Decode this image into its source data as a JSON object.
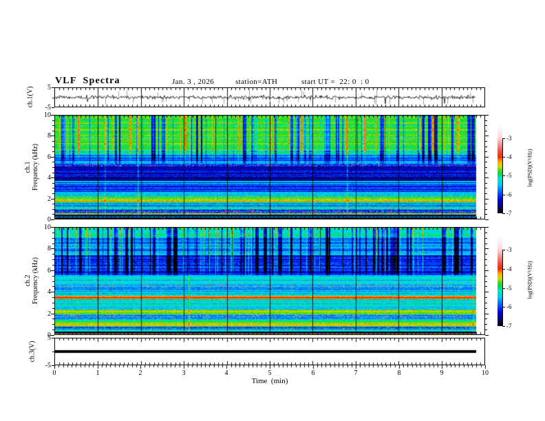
{
  "header": {
    "title": "VLF  Spectra",
    "date": "Jan. 3 , 2026",
    "station": "station=ATH",
    "start_ut": "start UT =  22: 0  : 0"
  },
  "time_axis": {
    "label": "Time  (min)",
    "ticks": [
      "0",
      "1",
      "2",
      "3",
      "4",
      "5",
      "6",
      "7",
      "8",
      "9",
      "10"
    ],
    "range_min": [
      0,
      10
    ],
    "minor_step_min": 0.1,
    "data_end_min": 9.8
  },
  "panels": {
    "ch1_wave": {
      "name": "ch.1(V)",
      "yticks": [
        "5",
        "-5"
      ],
      "ylim": [
        -5,
        5
      ]
    },
    "ch1_spec": {
      "name_line1": "ch.1",
      "name_line2": "Frequency  (kHz)",
      "yticks": [
        "10",
        "8",
        "6",
        "4",
        "2",
        "0"
      ],
      "ylim_khz": [
        0,
        10
      ]
    },
    "ch2_spec": {
      "name_line1": "ch.2",
      "name_line2": "Frequency  (kHz)",
      "yticks": [
        "10",
        "8",
        "6",
        "4",
        "2",
        "0"
      ],
      "ylim_khz": [
        0,
        10
      ]
    },
    "ch3_wave": {
      "name": "ch.3(V)",
      "yticks": [
        "5",
        "-5"
      ],
      "ylim": [
        -5,
        5
      ]
    }
  },
  "colorbar": {
    "label": "log(PSD)(V²/Hz)",
    "ticks": [
      "-3",
      "-4",
      "-5",
      "-6",
      "-7"
    ],
    "range": [
      -7,
      -2.2
    ],
    "stops": [
      [
        -7.0,
        "#000000"
      ],
      [
        -6.75,
        "#0a0a5a"
      ],
      [
        -6.3,
        "#0000e6"
      ],
      [
        -5.9,
        "#005aff"
      ],
      [
        -5.5,
        "#00c8ff"
      ],
      [
        -5.15,
        "#00e6c8"
      ],
      [
        -4.9,
        "#00dc50"
      ],
      [
        -4.7,
        "#50dc00"
      ],
      [
        -4.5,
        "#d2dc00"
      ],
      [
        -4.25,
        "#ffaa00"
      ],
      [
        -4.0,
        "#ff2800"
      ],
      [
        -3.7,
        "#ff4646"
      ],
      [
        -3.3,
        "#ff9696"
      ],
      [
        -3.0,
        "#ffd2d2"
      ],
      [
        -2.5,
        "#fff5f5"
      ],
      [
        -2.2,
        "#ffffff"
      ]
    ],
    "special_colors": {
      "saturated_gray": "#969696",
      "interference_magenta": "#b428b4"
    }
  },
  "chart_data": [
    {
      "type": "line",
      "panel": "ch.1(V) waveform",
      "xlabel": "Time (min)",
      "xrange": [
        0,
        9.8
      ],
      "ylim": [
        -5,
        5
      ],
      "description": "broadband noise around 0 V, rms about 0.5 V, frequent bipolar impulses reaching +/-5 V and gray dropout spikes to -4 V",
      "mean": 0,
      "std": 0.5,
      "spike_p": 0.012,
      "spike_amp": [
        1.0,
        4.8
      ],
      "gray_spikes": 44,
      "gray_amp": [
        1.2,
        4.2
      ],
      "grid_minutes": true
    },
    {
      "type": "heatmap",
      "panel": "ch.1 spectrogram",
      "xrange_min": [
        0,
        9.8
      ],
      "yrange_khz": [
        0,
        10
      ],
      "zlabel": "log(PSD)(V²/Hz)",
      "zrange": [
        -7,
        -3
      ],
      "bands": [
        {
          "f": [
            6.6,
            10.0
          ],
          "lv": -4.8,
          "nz": 0.18,
          "ra": 0.25,
          "mp": 0.002
        },
        {
          "f": [
            6.2,
            6.6
          ],
          "lv": -5.2,
          "nz": 0.2,
          "ra": 0.3
        },
        {
          "f": [
            5.35,
            6.2
          ],
          "lv": -5.75,
          "nz": 0.2,
          "ra": 0.35
        },
        {
          "f": [
            5.05,
            5.35
          ],
          "lv": -6.2,
          "nz": 0.3,
          "ra": 0.3,
          "gp": 0.1,
          "mp": 0.06
        },
        {
          "f": [
            3.65,
            5.05
          ],
          "lv": -6.45,
          "nz": 0.3,
          "ra": 0.4,
          "mp": 0.004
        },
        {
          "f": [
            3.5,
            3.65
          ],
          "lv": -5.35,
          "nz": 0.15,
          "ra": 0.2
        },
        {
          "f": [
            2.6,
            3.5
          ],
          "lv": -5.95,
          "nz": 0.25,
          "ra": 0.45
        },
        {
          "f": [
            2.1,
            2.6
          ],
          "lv": -5.5,
          "nz": 0.25,
          "ra": 0.4
        },
        {
          "f": [
            1.95,
            2.1
          ],
          "lv": -4.75,
          "nz": 0.2,
          "ra": 0.3
        },
        {
          "f": [
            1.7,
            1.95
          ],
          "lv": -4.5,
          "nz": 0.18,
          "ra": 0.25,
          "gp": 0.05
        },
        {
          "f": [
            1.55,
            1.7
          ],
          "lv": -4.85,
          "nz": 0.2,
          "ra": 0.3
        },
        {
          "f": [
            1.15,
            1.55
          ],
          "lv": -5.5,
          "nz": 0.25,
          "ra": 0.4
        },
        {
          "f": [
            0.95,
            1.15
          ],
          "lv": -5.05,
          "nz": 0.2,
          "ra": 0.3,
          "gp": 0.12
        },
        {
          "f": [
            0.8,
            0.95
          ],
          "lv": -5.9,
          "nz": 0.25,
          "ra": 0.3,
          "mp": 0.05
        },
        {
          "f": [
            0.55,
            0.8
          ],
          "lv": -6.1,
          "nz": 0.3,
          "ra": 0.3,
          "gp": 0.15,
          "mp": 0.12
        },
        {
          "f": [
            0.38,
            0.55
          ],
          "lv": -4.8,
          "nz": 0.2,
          "ra": 0.25
        },
        {
          "f": [
            0.22,
            0.38
          ],
          "lv": -6.7,
          "nz": 0.2,
          "ra": 0.2
        },
        {
          "f": [
            0.12,
            0.22
          ],
          "lv": -5.3,
          "nz": 0.35,
          "ra": 0.2
        },
        {
          "f": [
            0.0,
            0.12
          ],
          "lv": -6.9,
          "nz": 0.15,
          "ra": 0.1,
          "mp": 0.03
        }
      ],
      "streaks": {
        "fmin": 5.3,
        "fullAbove": 6.4,
        "darkStartP": 0.1,
        "darkMaxLen": 7,
        "darkAmp": [
          -0.8,
          -1.6
        ],
        "brightP": 0.07,
        "brightAmp": [
          0.3,
          0.55
        ],
        "fullBright": 3,
        "redCols": 6
      },
      "grid_minutes": true
    },
    {
      "type": "heatmap",
      "panel": "ch.2 spectrogram",
      "xrange_min": [
        0,
        9.8
      ],
      "yrange_khz": [
        0,
        10
      ],
      "zlabel": "log(PSD)(V²/Hz)",
      "zrange": [
        -7,
        -3
      ],
      "bands": [
        {
          "f": [
            9.0,
            10.0
          ],
          "lv": -5.15,
          "nz": 0.22,
          "ra": 0.3
        },
        {
          "f": [
            7.4,
            9.0
          ],
          "lv": -5.7,
          "nz": 0.25,
          "ra": 0.35
        },
        {
          "f": [
            5.55,
            7.4
          ],
          "lv": -6.25,
          "nz": 0.3,
          "ra": 0.4
        },
        {
          "f": [
            5.2,
            5.55
          ],
          "lv": -5.35,
          "nz": 0.2,
          "ra": 0.5
        },
        {
          "f": [
            4.75,
            5.2
          ],
          "lv": -5.45,
          "nz": 0.22,
          "ra": 0.35
        },
        {
          "f": [
            4.3,
            4.75
          ],
          "lv": -5.6,
          "nz": 0.25,
          "ra": 0.3,
          "gp": 0.18
        },
        {
          "f": [
            3.6,
            4.3
          ],
          "lv": -5.45,
          "nz": 0.25,
          "ra": 0.35
        },
        {
          "f": [
            3.52,
            3.6
          ],
          "lv": -4.5,
          "nz": 0.15,
          "ra": 0.2
        },
        {
          "f": [
            3.38,
            3.52
          ],
          "lv": -4.0,
          "nz": 0.12,
          "ra": 0.15
        },
        {
          "f": [
            3.3,
            3.38
          ],
          "lv": -4.55,
          "nz": 0.15,
          "ra": 0.2
        },
        {
          "f": [
            2.35,
            3.3
          ],
          "lv": -5.3,
          "nz": 0.25,
          "ra": 0.4
        },
        {
          "f": [
            1.9,
            2.35
          ],
          "lv": -4.6,
          "nz": 0.2,
          "ra": 0.3,
          "gp": 0.02
        },
        {
          "f": [
            1.45,
            1.9
          ],
          "lv": -5.7,
          "nz": 0.25,
          "ra": 0.3,
          "gp": 0.17
        },
        {
          "f": [
            1.1,
            1.45
          ],
          "lv": -5.15,
          "nz": 0.22,
          "ra": 0.3
        },
        {
          "f": [
            0.68,
            1.1
          ],
          "lv": -4.65,
          "nz": 0.22,
          "ra": 0.3
        },
        {
          "f": [
            0.42,
            0.68
          ],
          "lv": -5.9,
          "nz": 0.28,
          "ra": 0.3,
          "gp": 0.06,
          "mp": 0.1
        },
        {
          "f": [
            0.25,
            0.42
          ],
          "lv": -5.05,
          "nz": 0.25,
          "ra": 0.25
        },
        {
          "f": [
            0.08,
            0.25
          ],
          "lv": -6.8,
          "nz": 0.18,
          "ra": 0.15
        },
        {
          "f": [
            0.0,
            0.08
          ],
          "lv": -4.3,
          "nz": 0.2,
          "ra": 0.1
        }
      ],
      "streaks": {
        "fmin": 5.5,
        "fullAbove": 6.2,
        "darkStartP": 0.11,
        "darkMaxLen": 9,
        "darkAmp": [
          -0.6,
          -1.4
        ],
        "brightP": 0.08,
        "brightAmp": [
          0.45,
          1.0
        ],
        "fullBright": 2,
        "redCols": 0
      },
      "grid_minutes": true
    },
    {
      "type": "line",
      "panel": "ch.3(V) waveform",
      "xlabel": "Time (min)",
      "xrange": [
        0,
        9.8
      ],
      "ylim": [
        -5,
        5
      ],
      "description": "flat thick line at 0 V for the whole record (no signal)",
      "value": 0
    }
  ]
}
